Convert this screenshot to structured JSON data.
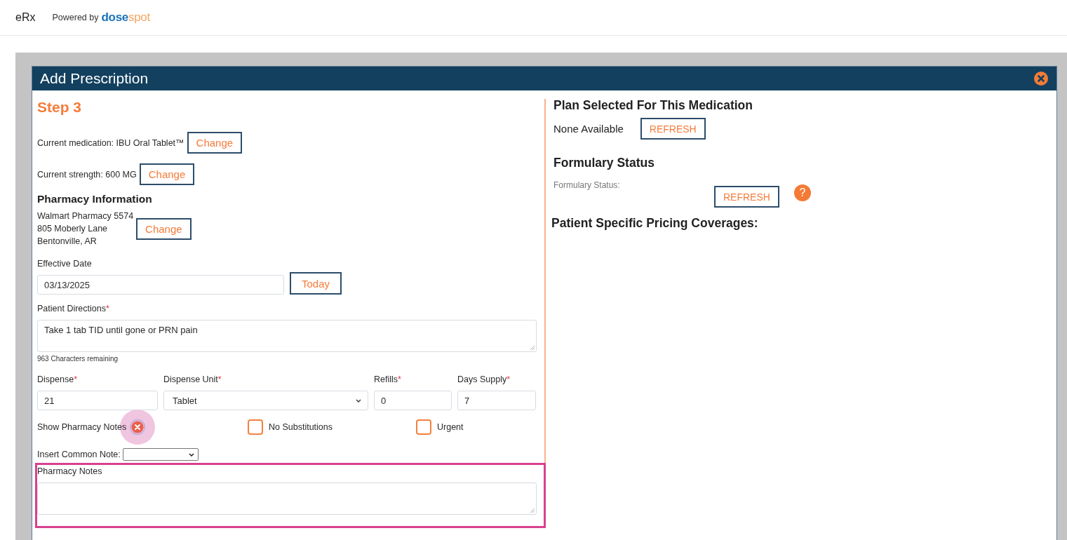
{
  "header": {
    "app_name": "eRx",
    "powered_by": "Powered by",
    "logo": {
      "part_1": "dose",
      "part_2": "spot"
    }
  },
  "dialog": {
    "title": "Add Prescription"
  },
  "step": {
    "title": "Step 3"
  },
  "medication": {
    "text": "Current medication: IBU Oral Tablet™",
    "button": "Change"
  },
  "strength": {
    "text": "Current strength: 600 MG",
    "button": "Change"
  },
  "pharmacy": {
    "heading": "Pharmacy Information",
    "lines": [
      "Walmart Pharmacy 5574",
      "805 Moberly Lane",
      "Bentonville, AR"
    ],
    "button": "Change"
  },
  "effective_date": {
    "label": "Effective Date",
    "value": "03/13/2025",
    "button": "Today"
  },
  "patient_directions": {
    "label": "Patient Directions",
    "required_mark": "*",
    "value": "Take 1 tab TID until gone or PRN pain",
    "hint": "963 Characters remaining"
  },
  "quantity_fields": [
    {
      "label": "Dispense",
      "required_mark": "*",
      "value": "21",
      "kind": "input"
    },
    {
      "label": "Dispense Unit",
      "required_mark": "*",
      "value": "Tablet",
      "kind": "select"
    },
    {
      "label": "Refills",
      "required_mark": "*",
      "value": "0",
      "kind": "input"
    },
    {
      "label": "Days Supply",
      "required_mark": "*",
      "value": "7",
      "kind": "input"
    }
  ],
  "options": [
    {
      "kind": "toggle",
      "label": "Show Pharmacy Notes",
      "highlighted": true
    },
    {
      "kind": "checkbox",
      "label": "No Substitutions",
      "checked": false
    },
    {
      "kind": "checkbox",
      "label": "Urgent",
      "checked": false
    }
  ],
  "common_note": {
    "label": "Insert Common Note:"
  },
  "pharmacy_notes": {
    "label": "Pharmacy Notes",
    "highlighted": true
  },
  "plan": {
    "heading": "Plan Selected For This Medication",
    "value": "None Available",
    "button": "REFRESH"
  },
  "formulary": {
    "heading": "Formulary Status",
    "label": "Formulary Status:",
    "button": "REFRESH",
    "help": "?"
  },
  "pricing": {
    "heading": "Patient Specific Pricing Coverages:"
  }
}
